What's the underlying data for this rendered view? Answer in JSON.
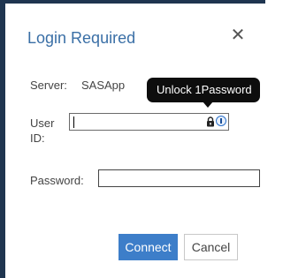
{
  "dialog": {
    "title": "Login Required",
    "close_icon": "close-icon",
    "close_glyph": "✕"
  },
  "form": {
    "server_label": "Server:",
    "server_value": "SASApp",
    "userid_label": "User ID:",
    "userid_value": "",
    "password_label": "Password:",
    "password_value": ""
  },
  "tooltip": {
    "text": "Unlock 1Password"
  },
  "buttons": {
    "connect_label": "Connect",
    "cancel_label": "Cancel"
  },
  "colors": {
    "accent": "#3d7ec9",
    "title": "#3a6fa6",
    "backdrop": "#1f3550"
  },
  "icons": {
    "lock": "lock-icon",
    "onepassword": "onepassword-icon"
  }
}
